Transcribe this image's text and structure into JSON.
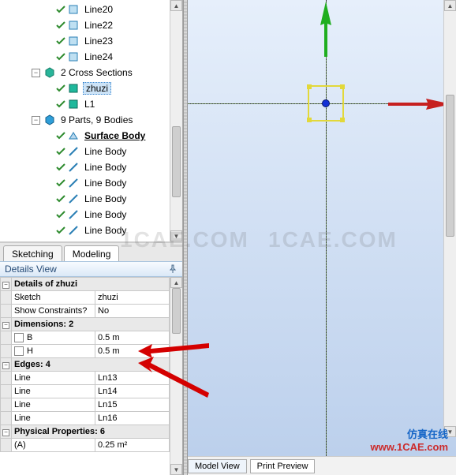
{
  "tree": {
    "lines": [
      "Line20",
      "Line22",
      "Line23",
      "Line24"
    ],
    "cross_sections": {
      "label": "2 Cross Sections",
      "items": [
        "zhuzi",
        "L1"
      ],
      "selected": "zhuzi"
    },
    "parts": {
      "label": "9 Parts, 9 Bodies",
      "surface": "Surface Body",
      "line_body": "Line Body",
      "line_body_count": 6
    }
  },
  "tabs": {
    "sketching": "Sketching",
    "modeling": "Modeling",
    "active": "modeling"
  },
  "details": {
    "title": "Details View",
    "header": "Details of zhuzi",
    "rows": {
      "sketch_k": "Sketch",
      "sketch_v": "zhuzi",
      "showc_k": "Show Constraints?",
      "showc_v": "No",
      "dim_h": "Dimensions: 2",
      "b_k": "B",
      "b_v": "0.5 m",
      "h_k": "H",
      "h_v": "0.5 m",
      "edges_h": "Edges: 4",
      "line1_k": "Line",
      "line1_v": "Ln13",
      "line2_k": "Line",
      "line2_v": "Ln14",
      "line3_k": "Line",
      "line3_v": "Ln15",
      "line4_k": "Line",
      "line4_v": "Ln16",
      "pp_h": "Physical Properties: 6",
      "a_k": "(A)",
      "a_v": "0.25 m²"
    }
  },
  "view_tabs": {
    "model": "Model View",
    "print": "Print Preview"
  },
  "branding": {
    "cn": "仿真在线",
    "url": "www.1CAE.com"
  },
  "watermark": "1CAE.COM",
  "icons": {
    "expand_minus": "−",
    "expand_plus": "+"
  }
}
